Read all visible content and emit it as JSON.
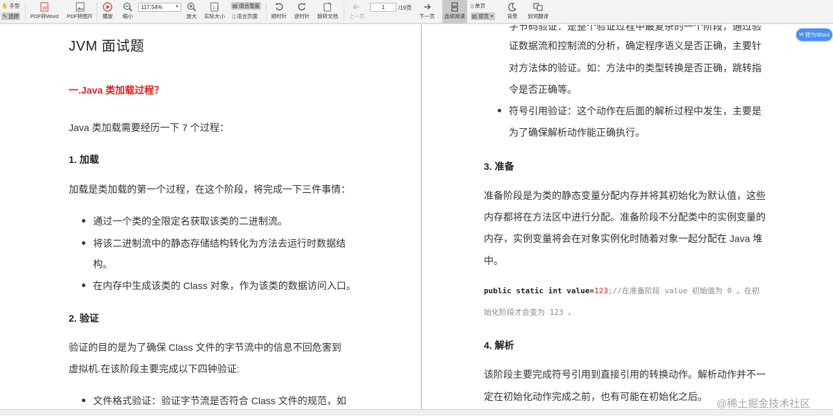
{
  "toolbar": {
    "hand_label": "手型",
    "select_label": "选择",
    "pdf_to_word": "PDF转Word",
    "pdf_to_image": "PDF转图片",
    "play": "播放",
    "zoom_out": "缩小",
    "zoom_value": "117.54%",
    "zoom_in": "放大",
    "actual_size": "实际大小",
    "fit_width": "适合宽度",
    "fit_page": "适合页面",
    "rotate_cw": "顺时针",
    "rotate_ccw": "逆时针",
    "rotate_doc": "旋转文档",
    "prev_page": "上一页",
    "page_current": "1",
    "page_total": "/19页",
    "next_page": "下一页",
    "continuous_read": "连续阅读",
    "single_page": "单页",
    "double_page": "双页",
    "background": "背景",
    "translate": "划词翻译"
  },
  "float_button": "转为Word",
  "watermark": "@稀土掘金技术社区",
  "left_page": {
    "title": "JVM 面试题",
    "section1": "一.Java  类加载过程？",
    "intro": "Java  类加载需要经历一下  7  个过程：",
    "h_load": "1.  加载",
    "load_desc": "加载是类加载的第一个过程，在这个阶段，将完成一下三件事情：",
    "load_items": [
      "通过一个类的全限定名获取该类的二进制流。",
      "将该二进制流中的静态存储结构转化为方法去运行时数据结",
      "构。",
      "在内存中生成该类的  Class  对象，作为该类的数据访问入口。"
    ],
    "h_verify": "2.  验证",
    "verify_desc_1": "验证的目的是为了确保  Class  文件的字节流中的信息不回危害到",
    "verify_desc_2": "虚拟机.在该阶段主要完成以下四钟验证:",
    "verify_item": "文件格式验证：验证字节流是否符合  Class  文件的规范，如"
  },
  "right_page": {
    "top_partial": "字节码验证：是整个验证过程中最复杂的一个阶段，通过验",
    "top_lines": [
      "证数据流和控制流的分析，确定程序语义是否正确，主要针",
      "对方法体的验证。如：方法中的类型转换是否正确，跳转指",
      "令是否正确等。"
    ],
    "symbol_line1": "符号引用验证：这个动作在后面的解析过程中发生，主要是",
    "symbol_line2": "为了确保解析动作能正确执行。",
    "h_prepare": "3.  准备",
    "prepare_lines": [
      "准备阶段是为类的静态变量分配内存并将其初始化为默认值，这些",
      "内存都将在方法区中进行分配。准备阶段不分配类中的实例变量的",
      "内存，实例变量将会在对象实例化时随着对象一起分配在  Java  堆",
      "中。"
    ],
    "code_keyword": "public static int value=",
    "code_number": "123",
    "code_comment": ";//在准备阶段 value 初始值为 0 。在初",
    "code_comment2": "始化阶段才会变为 123 。",
    "h_resolve": "4.  解析",
    "resolve_lines": [
      "该阶段主要完成符号引用到直接引用的转换动作。解析动作并不一",
      "定在初始化动作完成之前，也有可能在初始化之后。"
    ]
  }
}
